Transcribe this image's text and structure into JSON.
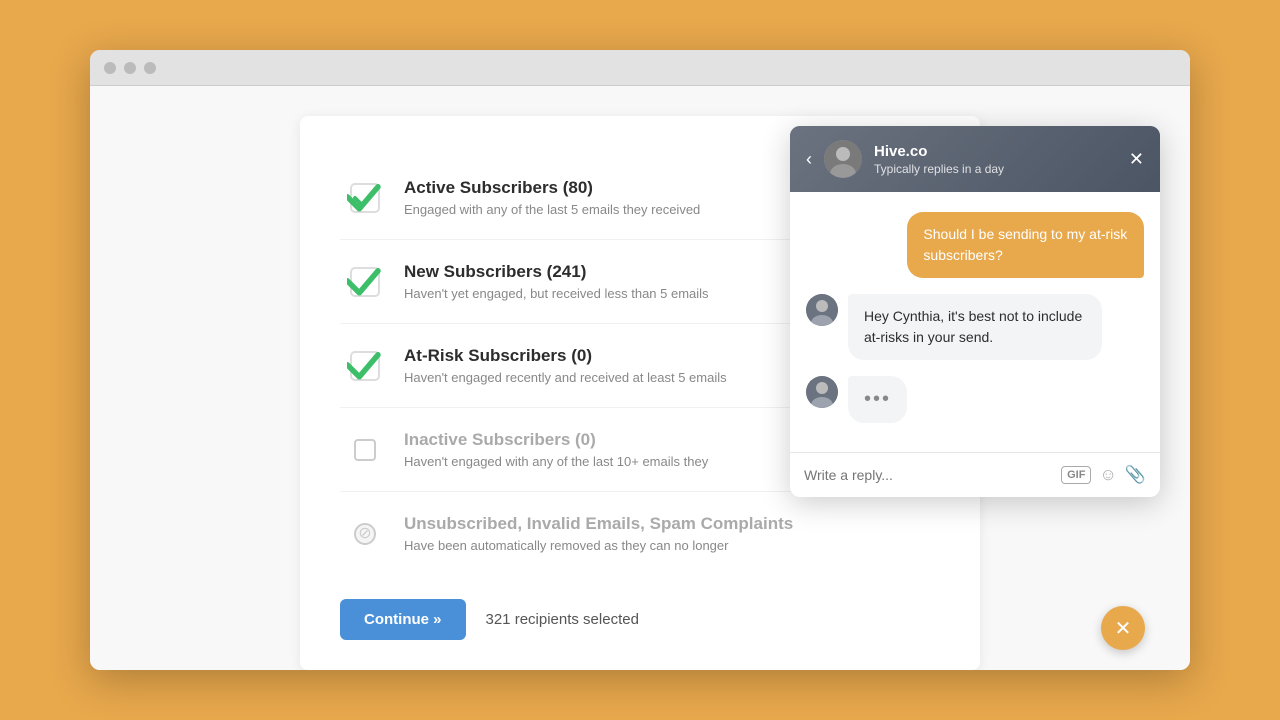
{
  "browser": {
    "dots": [
      "dot1",
      "dot2",
      "dot3"
    ]
  },
  "subscribers": [
    {
      "id": "active",
      "title": "Active Subscribers (80)",
      "description": "Engaged with any of the last 5 emails they received",
      "state": "checked",
      "disabled": false
    },
    {
      "id": "new",
      "title": "New Subscribers (241)",
      "description": "Haven't yet engaged, but received less than 5 emails",
      "state": "checked",
      "disabled": false
    },
    {
      "id": "at-risk",
      "title": "At-Risk Subscribers (0)",
      "description": "Haven't engaged recently and received at least 5 emails",
      "state": "checked",
      "disabled": false
    },
    {
      "id": "inactive",
      "title": "Inactive Subscribers (0)",
      "description": "Haven't engaged with any of the last 10+ emails they",
      "state": "empty",
      "disabled": false
    },
    {
      "id": "unsubscribed",
      "title": "Unsubscribed, Invalid Emails, Spam Complaints",
      "description": "Have been automatically removed as they can no longer",
      "state": "disabled",
      "disabled": true
    }
  ],
  "footer": {
    "continue_label": "Continue »",
    "recipients_text": "321 recipients selected"
  },
  "chat": {
    "header": {
      "name": "Hive.co",
      "status": "Typically replies in a day"
    },
    "messages": [
      {
        "type": "sent",
        "text": "Should I be sending to my at-risk subscribers?"
      },
      {
        "type": "received",
        "text": "Hey Cynthia, it's best not to include at-risks in your send."
      },
      {
        "type": "typing",
        "text": "•••"
      }
    ],
    "input_placeholder": "Write a reply...",
    "gif_label": "GIF"
  }
}
